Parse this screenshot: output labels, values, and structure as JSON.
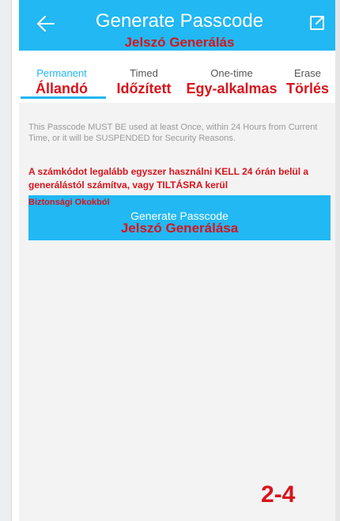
{
  "header": {
    "title": "Generate Passcode",
    "annotation": "Jelszó Generálás",
    "back_icon": "arrow-left-icon",
    "share_icon": "open-external-icon",
    "color": "#21b8f3"
  },
  "tabs": [
    {
      "label": "Permanent",
      "annotation": "Állandó",
      "active": true
    },
    {
      "label": "Timed",
      "annotation": "Időzített",
      "active": false
    },
    {
      "label": "One-time",
      "annotation": "Egy-alkalmas",
      "active": false
    },
    {
      "label": "Erase",
      "annotation": "Törlés",
      "active": false
    }
  ],
  "notice": {
    "text": "This Passcode MUST BE used at least Once, within 24 Hours from Current Time, or it will be SUSPENDED for Security Reasons.",
    "annotation": "A számkódot legalább egyszer használni KELL 24 órán belül a generálástól számítva, vagy TILTÁSRA kerül"
  },
  "generate_button": {
    "annotation_top": "Biztonsági Okokból",
    "label": "Generate Passcode",
    "annotation": "Jelszó Generálása"
  },
  "page_number": "2-4",
  "annotation_color": "#d8141c"
}
